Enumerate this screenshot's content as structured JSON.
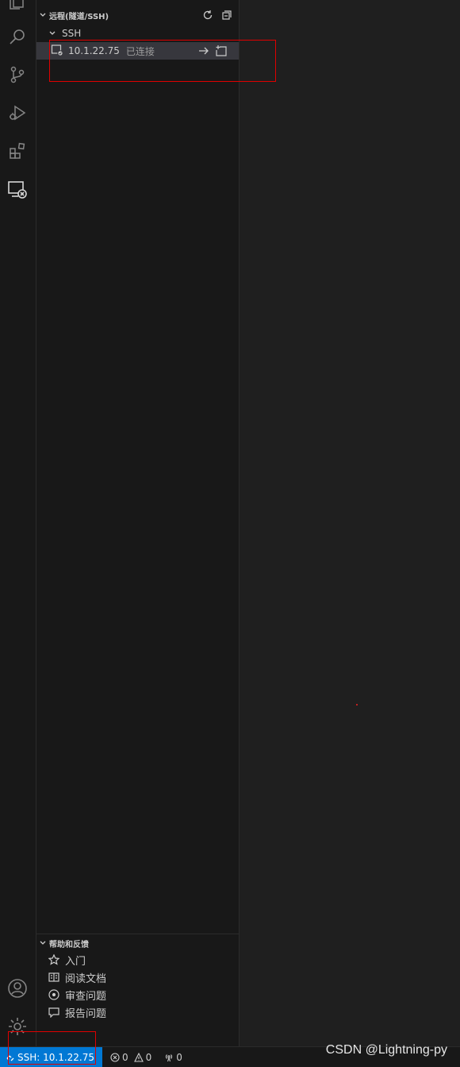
{
  "remote_explorer": {
    "title": "远程(隧道/SSH)",
    "group_label": "SSH",
    "host": {
      "name": "10.1.22.75",
      "status": "已连接"
    }
  },
  "help": {
    "title": "帮助和反馈",
    "items": [
      {
        "label": "入门",
        "icon": "star-icon"
      },
      {
        "label": "阅读文档",
        "icon": "book-icon"
      },
      {
        "label": "审查问题",
        "icon": "issues-icon"
      },
      {
        "label": "报告问题",
        "icon": "comment-icon"
      }
    ]
  },
  "statusbar": {
    "remote_label": "SSH: 10.1.22.75",
    "errors": "0",
    "warnings": "0",
    "ports": "0"
  },
  "watermark": "CSDN @Lightning-py",
  "colors": {
    "accent": "#0078d4",
    "highlight": "#e00000",
    "sidebar_bg": "#181818",
    "editor_bg": "#1f1f1f",
    "selected_row": "#37373d"
  }
}
